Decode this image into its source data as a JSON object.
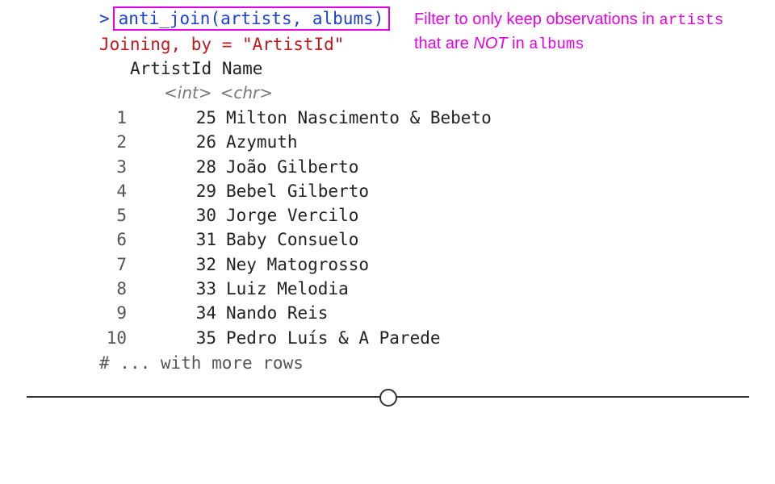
{
  "console": {
    "prompt_symbol": ">",
    "command": "anti_join(artists, albums)",
    "message": "Joining, by = \"ArtistId\"",
    "columns": [
      "ArtistId",
      "Name"
    ],
    "column_types": [
      "<int>",
      "<chr>"
    ],
    "rows": [
      {
        "num": "1",
        "id": "25",
        "name": "Milton Nascimento & Bebeto"
      },
      {
        "num": "2",
        "id": "26",
        "name": "Azymuth"
      },
      {
        "num": "3",
        "id": "28",
        "name": "João Gilberto"
      },
      {
        "num": "4",
        "id": "29",
        "name": "Bebel Gilberto"
      },
      {
        "num": "5",
        "id": "30",
        "name": "Jorge Vercilo"
      },
      {
        "num": "6",
        "id": "31",
        "name": "Baby Consuelo"
      },
      {
        "num": "7",
        "id": "32",
        "name": "Ney Matogrosso"
      },
      {
        "num": "8",
        "id": "33",
        "name": "Luiz Melodia"
      },
      {
        "num": "9",
        "id": "34",
        "name": "Nando Reis"
      },
      {
        "num": "10",
        "id": "35",
        "name": "Pedro Luís & A Parede"
      }
    ],
    "footer": "# ... with more rows"
  },
  "annotation": {
    "text1": "Filter to only keep observations in ",
    "code1": "artists",
    "text2": "that are ",
    "emph": "NOT",
    "text3": " in ",
    "code2": "albums"
  },
  "colors": {
    "highlight": "#e600e6",
    "prompt": "#1a3fd6",
    "message": "#c0181d"
  },
  "scrubber": {
    "position_fraction": 0.5
  }
}
